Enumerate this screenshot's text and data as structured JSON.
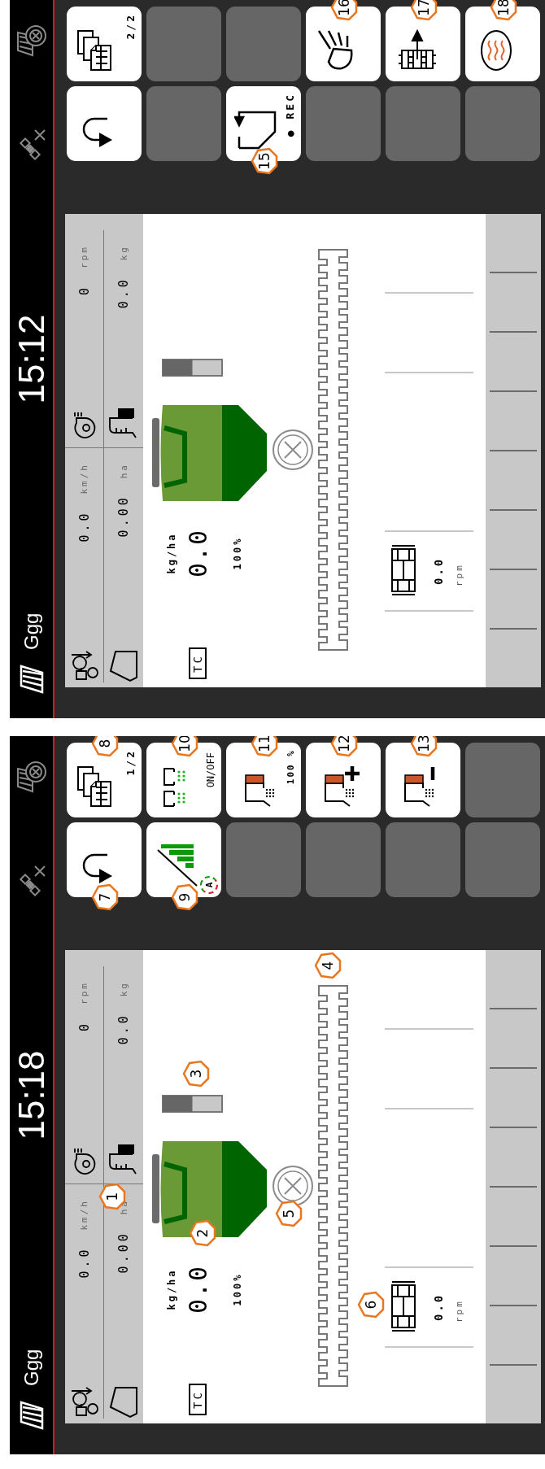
{
  "screens": [
    {
      "status_bar": {
        "title": "Ggg",
        "time": "15:12"
      },
      "readouts": [
        {
          "kind": "speed",
          "value": "0.0",
          "unit": "km/h"
        },
        {
          "kind": "fan",
          "value": "0",
          "unit": "rpm"
        },
        {
          "kind": "area",
          "value": "0.00",
          "unit": "ha"
        },
        {
          "kind": "tank",
          "value": "0.0",
          "unit": "kg"
        }
      ],
      "mode_label": "TC",
      "rate": {
        "unit": "kg/ha",
        "value": "0.0",
        "percent": "100%"
      },
      "hopper": {
        "level": 0.5
      },
      "roller": {
        "value": "0.0",
        "unit": "rpm"
      },
      "buttons": [
        {
          "kind": "back"
        },
        {
          "kind": "pages",
          "label": "2/2"
        },
        {
          "kind": "blank"
        },
        {
          "kind": "blank"
        },
        {
          "kind": "record",
          "label": "● REC",
          "callout": "15"
        },
        {
          "kind": "blank"
        },
        {
          "kind": "blank"
        },
        {
          "kind": "headlight",
          "callout": "16"
        },
        {
          "kind": "blank"
        },
        {
          "kind": "roller-drive",
          "callout": "17"
        },
        {
          "kind": "blank"
        },
        {
          "kind": "heater",
          "callout": "18"
        }
      ]
    },
    {
      "status_bar": {
        "title": "Ggg",
        "time": "15:18"
      },
      "readouts": [
        {
          "kind": "speed",
          "value": "0.0",
          "unit": "km/h"
        },
        {
          "kind": "fan",
          "value": "0",
          "unit": "rpm"
        },
        {
          "kind": "area",
          "value": "0.00",
          "unit": "ha"
        },
        {
          "kind": "tank",
          "value": "0.0",
          "unit": "kg"
        }
      ],
      "mode_label": "TC",
      "rate": {
        "unit": "kg/ha",
        "value": "0.0",
        "percent": "100%"
      },
      "hopper": {
        "level": 0.5
      },
      "roller": {
        "value": "0.0",
        "unit": "rpm"
      },
      "callouts": {
        "readouts": "1",
        "hopper": "2",
        "fill_level": "3",
        "dosing_shaft": "4",
        "metering_wheel": "5",
        "roller": "6"
      },
      "buttons": [
        {
          "kind": "back",
          "callout": "7"
        },
        {
          "kind": "pages",
          "label": "1/2",
          "callout": "8"
        },
        {
          "kind": "rate-auto",
          "label": "A",
          "callout": "9"
        },
        {
          "kind": "sections",
          "label": "ON/OFF",
          "callout": "10"
        },
        {
          "kind": "blank"
        },
        {
          "kind": "tank-percent",
          "label": "100 %",
          "callout": "11"
        },
        {
          "kind": "blank"
        },
        {
          "kind": "tank-plus",
          "callout": "12"
        },
        {
          "kind": "blank"
        },
        {
          "kind": "tank-minus",
          "callout": "13"
        },
        {
          "kind": "blank"
        },
        {
          "kind": "blank"
        }
      ]
    }
  ]
}
